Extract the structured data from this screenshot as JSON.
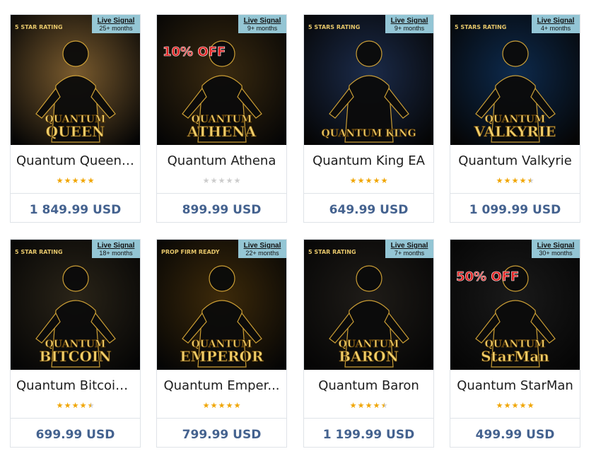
{
  "colors": {
    "price": "#44628f",
    "star_on": "#f0a500",
    "star_off": "#cccccc",
    "live_badge": "#9fd6e6",
    "gold": "#d4a537"
  },
  "products": [
    {
      "name": "Quantum Queen ...",
      "rating": 5,
      "price": "1 849.99 USD",
      "badge_line1": "Live Signal",
      "badge_line2": "25+ months",
      "art_title": "QUANTUM\nQUEEN",
      "art_top": "5 STAR RATING",
      "art_promo": "",
      "theme": "#7a5b2e"
    },
    {
      "name": "Quantum Athena",
      "rating": 0,
      "price": "899.99 USD",
      "badge_line1": "Live Signal",
      "badge_line2": "9+ months",
      "art_title": "QUANTUM\nATHENA",
      "art_top": "",
      "art_promo": "10% OFF",
      "theme": "#3a2a10"
    },
    {
      "name": "Quantum King EA",
      "rating": 5,
      "price": "649.99 USD",
      "badge_line1": "Live Signal",
      "badge_line2": "9+ months",
      "art_title": "QUANTUM KING",
      "art_top": "5 STARS RATING",
      "art_promo": "",
      "theme": "#1b2b4a"
    },
    {
      "name": "Quantum Valkyrie",
      "rating": 4.5,
      "price": "1 099.99 USD",
      "badge_line1": "Live Signal",
      "badge_line2": "4+ months",
      "art_title": "QUANTUM\nVALKYRIE",
      "art_top": "5 STARS RATING",
      "art_promo": "",
      "theme": "#0d2a4d"
    },
    {
      "name": "Quantum Bitcoin...",
      "rating": 4.5,
      "price": "699.99 USD",
      "badge_line1": "Live Signal",
      "badge_line2": "18+ months",
      "art_title": "QUANTUM\nBITCOIN",
      "art_top": "5 STAR RATING",
      "art_promo": "",
      "theme": "#2a2418"
    },
    {
      "name": "Quantum Emper...",
      "rating": 5,
      "price": "799.99 USD",
      "badge_line1": "Live Signal",
      "badge_line2": "22+ months",
      "art_title": "QUANTUM\nEMPEROR",
      "art_top": "PROP FIRM READY",
      "art_promo": "",
      "theme": "#3d2a0a"
    },
    {
      "name": "Quantum Baron",
      "rating": 4.5,
      "price": "1 199.99 USD",
      "badge_line1": "Live Signal",
      "badge_line2": "7+ months",
      "art_title": "QUANTUM\nBARON",
      "art_top": "5 STAR RATING",
      "art_promo": "",
      "theme": "#1f1c18"
    },
    {
      "name": "Quantum StarMan",
      "rating": 5,
      "price": "499.99 USD",
      "badge_line1": "Live Signal",
      "badge_line2": "30+ months",
      "art_title": "QUANTUM\nStarMan",
      "art_top": "",
      "art_promo": "50% OFF",
      "theme": "#1a1a1a"
    }
  ]
}
